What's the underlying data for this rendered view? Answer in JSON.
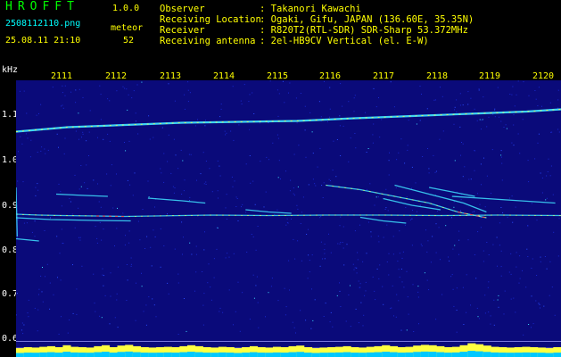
{
  "header": {
    "app_title": "HROFFT",
    "app_version": "1.0.0",
    "file_name": "2508112110.png",
    "meteor_label": "meteor",
    "date_time": "25.08.11 21:10",
    "meteor_count": "52"
  },
  "info": [
    {
      "key": "Observer",
      "value": ": Takanori Kawachi"
    },
    {
      "key": "Receiving Location",
      "value": ": Ogaki, Gifu, JAPAN (136.60E, 35.35N)"
    },
    {
      "key": "Receiver",
      "value": ": R820T2(RTL-SDR) SDR-Sharp 53.372MHz"
    },
    {
      "key": "Receiving antenna",
      "value": ": 2el-HB9CV Vertical (el. E-W)"
    }
  ],
  "colors": {
    "background": "#000000",
    "title": "#00ff00",
    "version": "#ffff00",
    "text_cyan": "#00ffff",
    "text_white": "#ffffff",
    "text_yellow": "#ffff00",
    "plot_bg": "#0a0a7a",
    "trace_cyan": "#40e0ff",
    "trace_yellow": "#ffff40",
    "trace_red": "#ff4040",
    "level_cyan": "#00c8ff"
  },
  "chart_data": {
    "type": "heatmap",
    "ylabel": "kHz",
    "y_ticks": [
      "1.1",
      "1.0",
      "0.9",
      "0.8",
      "0.7",
      "0.6"
    ],
    "x_ticks": [
      "2111",
      "2112",
      "2113",
      "2114",
      "2115",
      "2116",
      "2117",
      "2118",
      "2119",
      "2120"
    ],
    "ylim": [
      0.58,
      1.2
    ],
    "xlim": [
      2110.6,
      2120.1
    ],
    "grid": false,
    "traces": [
      {
        "name": "carrier",
        "x": [
          2110.6,
          2111.5,
          2112.5,
          2113.5,
          2114.5,
          2115.5,
          2116.5,
          2117.5,
          2118.5,
          2119.5,
          2120.1
        ],
        "y": [
          1.085,
          1.095,
          1.1,
          1.105,
          1.107,
          1.109,
          1.115,
          1.12,
          1.125,
          1.13,
          1.135
        ]
      },
      {
        "name": "echo-main",
        "x": [
          2110.6,
          2111.0,
          2111.4,
          2112.0,
          2112.5,
          2113.0,
          2114.0,
          2115.0,
          2116.0,
          2117.0,
          2118.0,
          2119.0,
          2120.1
        ],
        "y": [
          0.9,
          0.898,
          0.897,
          0.896,
          0.895,
          0.896,
          0.898,
          0.897,
          0.898,
          0.898,
          0.897,
          0.898,
          0.897
        ]
      },
      {
        "name": "echo-2",
        "x": [
          2110.6,
          2111.2,
          2112.0,
          2112.6
        ],
        "y": [
          0.892,
          0.888,
          0.886,
          0.885
        ]
      },
      {
        "name": "echo-3",
        "x": [
          2111.3,
          2111.8,
          2112.2
        ],
        "y": [
          0.945,
          0.942,
          0.94
        ]
      },
      {
        "name": "echo-4",
        "x": [
          2112.9,
          2113.5,
          2113.9
        ],
        "y": [
          0.936,
          0.93,
          0.925
        ]
      },
      {
        "name": "echo-5",
        "x": [
          2110.6,
          2111.0
        ],
        "y": [
          0.845,
          0.84
        ]
      },
      {
        "name": "echo-6",
        "x": [
          2116.0,
          2116.6,
          2117.2,
          2117.8,
          2118.3,
          2118.8
        ],
        "y": [
          0.965,
          0.955,
          0.94,
          0.925,
          0.905,
          0.892
        ]
      },
      {
        "name": "echo-7",
        "x": [
          2117.2,
          2117.8,
          2118.4,
          2118.8
        ],
        "y": [
          0.965,
          0.945,
          0.925,
          0.905
        ]
      },
      {
        "name": "echo-8",
        "x": [
          2117.0,
          2117.5,
          2118.0
        ],
        "y": [
          0.935,
          0.92,
          0.91
        ]
      },
      {
        "name": "echo-9",
        "x": [
          2118.2,
          2118.8,
          2119.4,
          2120.0
        ],
        "y": [
          0.94,
          0.935,
          0.93,
          0.925
        ]
      },
      {
        "name": "echo-10",
        "x": [
          2117.8,
          2118.2,
          2118.6
        ],
        "y": [
          0.96,
          0.95,
          0.94
        ]
      },
      {
        "name": "echo-11",
        "x": [
          2116.6,
          2117.0,
          2117.4
        ],
        "y": [
          0.893,
          0.885,
          0.88
        ]
      },
      {
        "name": "echo-12",
        "x": [
          2114.6,
          2115.0,
          2115.4
        ],
        "y": [
          0.91,
          0.905,
          0.902
        ]
      },
      {
        "name": "echo-13",
        "x": [
          2110.6,
          2110.62
        ],
        "y": [
          0.96,
          0.85
        ]
      }
    ],
    "levels": [
      0.45,
      0.5,
      0.48,
      0.52,
      0.55,
      0.5,
      0.6,
      0.52,
      0.5,
      0.48,
      0.55,
      0.6,
      0.5,
      0.58,
      0.62,
      0.55,
      0.5,
      0.48,
      0.5,
      0.52,
      0.5,
      0.55,
      0.6,
      0.55,
      0.5,
      0.48,
      0.52,
      0.5,
      0.45,
      0.5,
      0.55,
      0.5,
      0.48,
      0.52,
      0.5,
      0.55,
      0.58,
      0.5,
      0.45,
      0.48,
      0.5,
      0.52,
      0.55,
      0.5,
      0.48,
      0.52,
      0.55,
      0.6,
      0.55,
      0.5,
      0.52,
      0.58,
      0.62,
      0.6,
      0.55,
      0.5,
      0.52,
      0.6,
      0.7,
      0.65,
      0.58,
      0.52,
      0.5,
      0.48,
      0.5,
      0.52,
      0.5,
      0.48,
      0.45,
      0.5
    ]
  }
}
